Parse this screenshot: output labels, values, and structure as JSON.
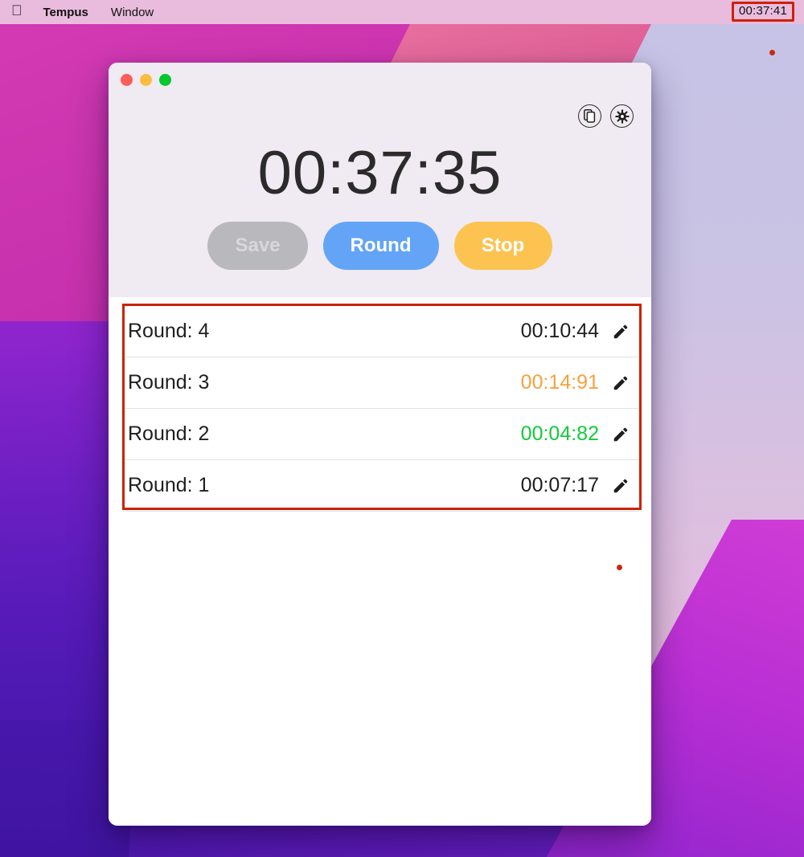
{
  "menubar": {
    "apple_icon": "apple-logo-icon",
    "app_name": "Tempus",
    "items": [
      "Window"
    ],
    "window_menu": "Window",
    "clock": "00:37:41",
    "clock_highlighted": true,
    "background_color": "#e9bcde"
  },
  "window": {
    "traffic_lights": {
      "close_color": "#fb5d57",
      "minimize_color": "#fbbd41",
      "maximize_color": "#00c82e"
    },
    "header_background": "#f0eaf2",
    "actions": [
      {
        "name": "copy-icon",
        "label": "Copy"
      },
      {
        "name": "gear-icon",
        "label": "Settings"
      }
    ],
    "timer": "00:37:35",
    "controls": [
      {
        "label": "Save",
        "state": "disabled",
        "color": "#b9b8bd"
      },
      {
        "label": "Round",
        "state": "enabled",
        "color": "#63a4f7"
      },
      {
        "label": "Stop",
        "state": "enabled",
        "color": "#fcc351"
      }
    ]
  },
  "rounds": {
    "highlighted": true,
    "highlight_color": "#cc2200",
    "fastest_color": "#12cb3a",
    "slowest_color": "#f7a13c",
    "items": [
      {
        "label": "Round: 4",
        "time": "00:10:44",
        "style": "normal"
      },
      {
        "label": "Round: 3",
        "time": "00:14:91",
        "style": "slowest"
      },
      {
        "label": "Round: 2",
        "time": "00:04:82",
        "style": "fastest"
      },
      {
        "label": "Round: 1",
        "time": "00:07:17",
        "style": "normal"
      }
    ]
  },
  "annotations": {
    "dot_color": "#c62a10",
    "dots": [
      {
        "name": "annotation-dot-top"
      },
      {
        "name": "annotation-dot-middle"
      }
    ]
  }
}
